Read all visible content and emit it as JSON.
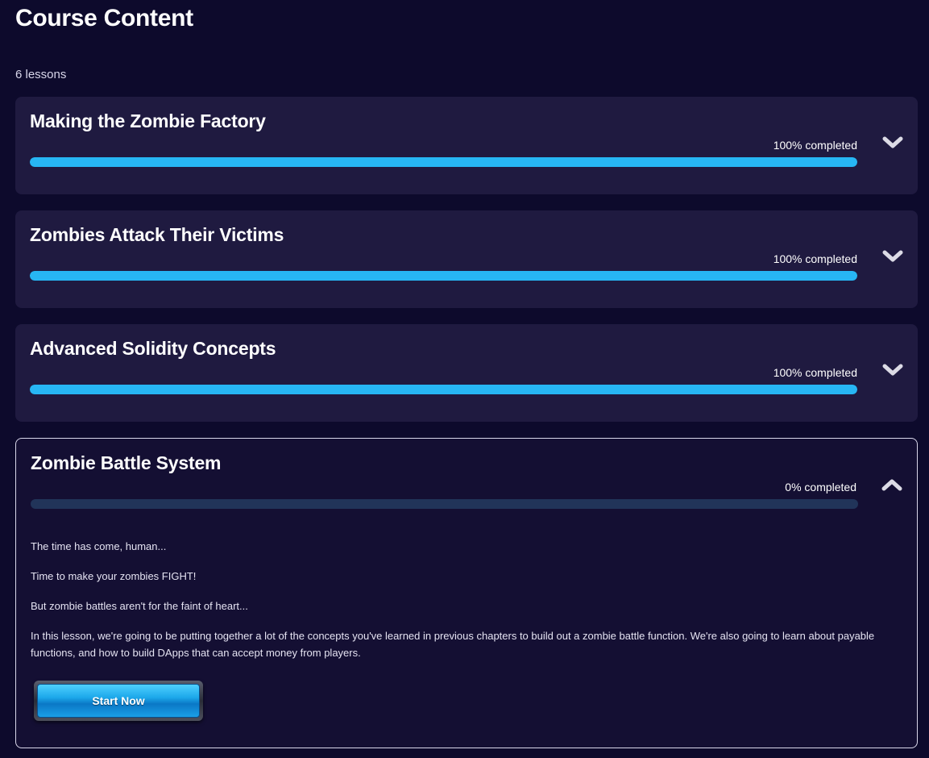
{
  "page": {
    "title": "Course Content",
    "lesson_count": "6 lessons"
  },
  "lessons": [
    {
      "title": "Making the Zombie Factory",
      "progress_label": "100% completed",
      "progress": 1.0,
      "expanded": false
    },
    {
      "title": "Zombies Attack Their Victims",
      "progress_label": "100% completed",
      "progress": 1.0,
      "expanded": false
    },
    {
      "title": "Advanced Solidity Concepts",
      "progress_label": "100% completed",
      "progress": 1.0,
      "expanded": false
    },
    {
      "title": "Zombie Battle System",
      "progress_label": "0% completed",
      "progress": 0.0,
      "expanded": true,
      "description": [
        "The time has come, human...",
        "Time to make your zombies FIGHT!",
        "But zombie battles aren't for the faint of heart...",
        "In this lesson, we're going to be putting together a lot of the concepts you've learned in previous chapters to build out a zombie battle function. We're also going to learn about payable functions, and how to build DApps that can accept money from players."
      ],
      "button_label": "Start Now"
    }
  ],
  "icons": {
    "collapsed": "chevron-down-icon",
    "expanded": "chevron-up-icon"
  },
  "colors": {
    "background": "#0d0a2c",
    "card": "#1f1a40",
    "progress_fill": "#27b6f4",
    "progress_track": "#213459"
  }
}
